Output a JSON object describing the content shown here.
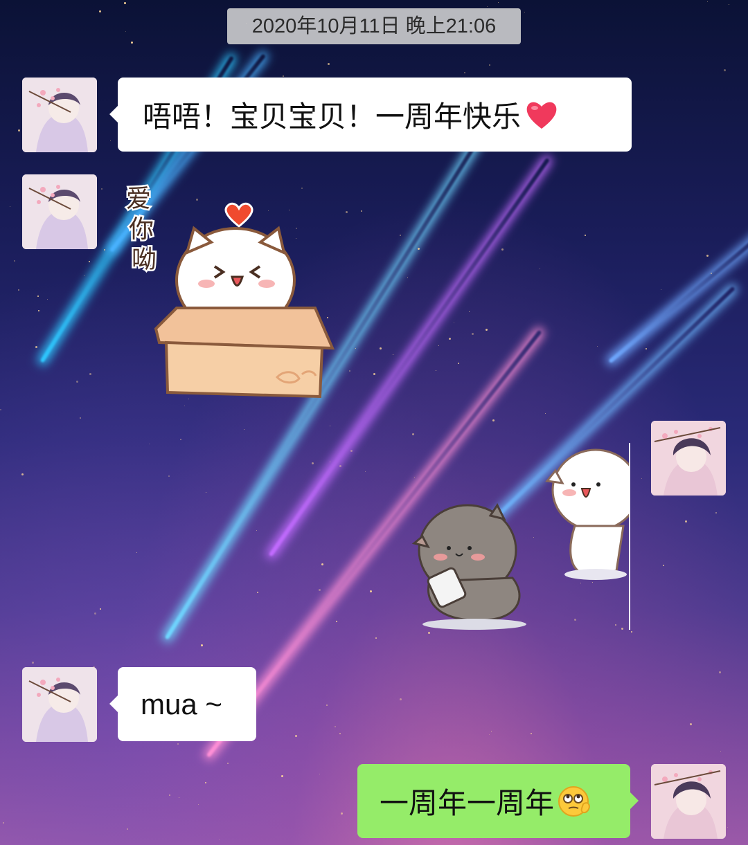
{
  "chat": {
    "timestamp": "2020年10月11日 晚上21:06",
    "messages": [
      {
        "side": "left",
        "type": "text",
        "text": "唔唔！宝贝宝贝！一周年快乐",
        "emoji": "red-heart"
      },
      {
        "side": "left",
        "type": "sticker",
        "sticker": "white-cat-in-box",
        "caption": "爱你呦"
      },
      {
        "side": "right",
        "type": "sticker",
        "sticker": "grey-cat-with-phone-and-white-cat-peeking"
      },
      {
        "side": "left",
        "type": "text",
        "text": "mua ~"
      },
      {
        "side": "right",
        "type": "text",
        "text": "一周年一周年",
        "emoji": "rolling-eyes-face"
      }
    ]
  },
  "colors": {
    "incoming_bubble": "#ffffff",
    "outgoing_bubble": "#95ec69",
    "timestamp_bg": "#d2d2d2"
  }
}
